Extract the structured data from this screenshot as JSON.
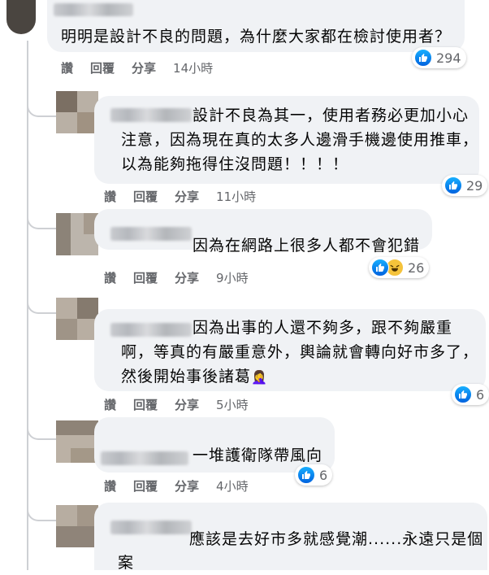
{
  "actions": {
    "like": "讚",
    "reply": "回覆",
    "share": "分享"
  },
  "colors": {
    "like_blue": "#0866ff",
    "bubble_bg": "#f0f2f5",
    "meta_gray": "#65676b"
  },
  "comments": [
    {
      "lines": [
        "明明是設計不良的問題，為什麼大家都在檢討使用者？"
      ],
      "time": "14小時",
      "reactions": {
        "icons": [
          "like-icon"
        ],
        "count": "294"
      }
    },
    {
      "lines": [
        "設計不良為其一，使用者務必更加小心",
        "注意，因為現在真的太多人邊滑手機邊使用推車，",
        "以為能夠拖得住沒問題！！！！"
      ],
      "time": "11小時",
      "reactions": {
        "icons": [
          "like-icon"
        ],
        "count": "29"
      }
    },
    {
      "lines": [
        "因為在網路上很多人都不會犯錯"
      ],
      "time": "9小時",
      "reactions": {
        "icons": [
          "like-icon",
          "haha-icon"
        ],
        "count": "26"
      }
    },
    {
      "lines": [
        "因為出事的人還不夠多，跟不夠嚴重",
        "啊，等真的有嚴重意外，輿論就會轉向好市多了，",
        "然後開始事後諸葛"
      ],
      "emoji": "🤦‍♀️",
      "emoji_icon": "facepalm-emoji-icon",
      "time": "5小時",
      "reactions": {
        "icons": [
          "like-icon"
        ],
        "count": "6"
      }
    },
    {
      "lines": [
        "一堆護衛隊帶風向"
      ],
      "time": "4小時",
      "reactions": {
        "icons": [
          "like-icon"
        ],
        "count": "6"
      }
    },
    {
      "lines": [
        "應該是去好市多就感覺潮......永遠只是個",
        "案"
      ]
    }
  ]
}
